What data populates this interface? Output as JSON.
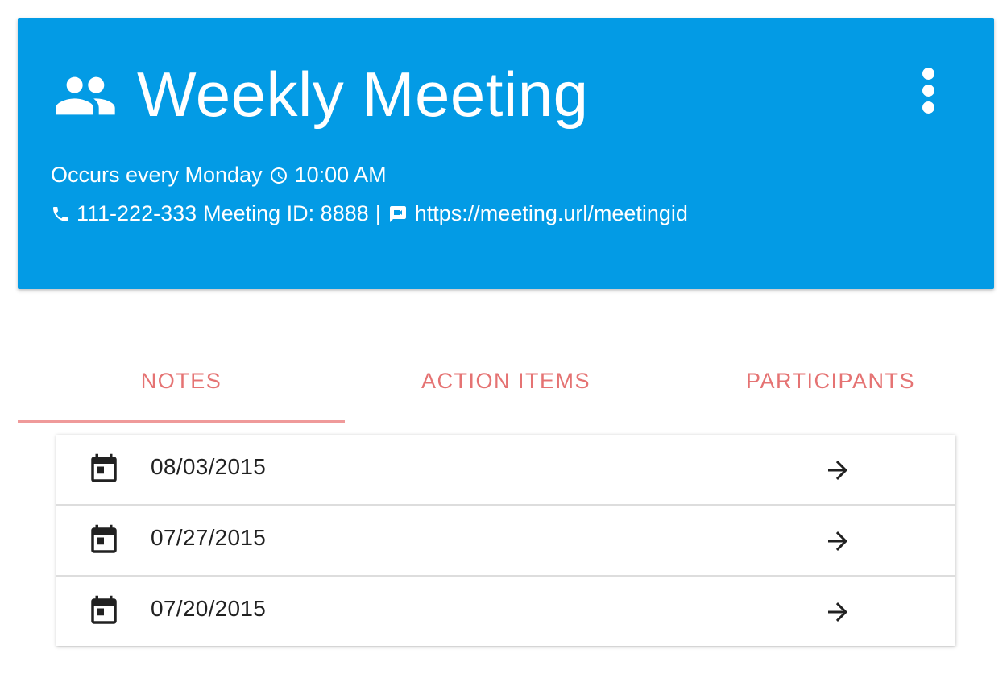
{
  "colors": {
    "header_bg": "#039be5",
    "header_text": "#ffffff",
    "tab_text": "#e57373",
    "tab_indicator": "#ef9a9a",
    "row_text": "#212121",
    "icon": "#212121"
  },
  "header": {
    "icon": "people-icon",
    "title": "Weekly Meeting",
    "menu_icon": "more-vert-icon",
    "schedule_text": "Occurs every Monday",
    "time_icon": "clock-icon",
    "time": "10:00 AM",
    "phone_icon": "phone-icon",
    "phone": "111-222-333",
    "meeting_id_text": "Meeting ID: 8888",
    "separator": "|",
    "video_icon": "video-icon",
    "meeting_url": "https://meeting.url/meetingid"
  },
  "tabs": [
    {
      "label": "NOTES",
      "active": true
    },
    {
      "label": "ACTION ITEMS",
      "active": false
    },
    {
      "label": "PARTICIPANTS",
      "active": false
    }
  ],
  "notes": [
    {
      "icon": "calendar-icon",
      "date": "08/03/2015",
      "action_icon": "arrow-forward-icon"
    },
    {
      "icon": "calendar-icon",
      "date": "07/27/2015",
      "action_icon": "arrow-forward-icon"
    },
    {
      "icon": "calendar-icon",
      "date": "07/20/2015",
      "action_icon": "arrow-forward-icon"
    }
  ]
}
